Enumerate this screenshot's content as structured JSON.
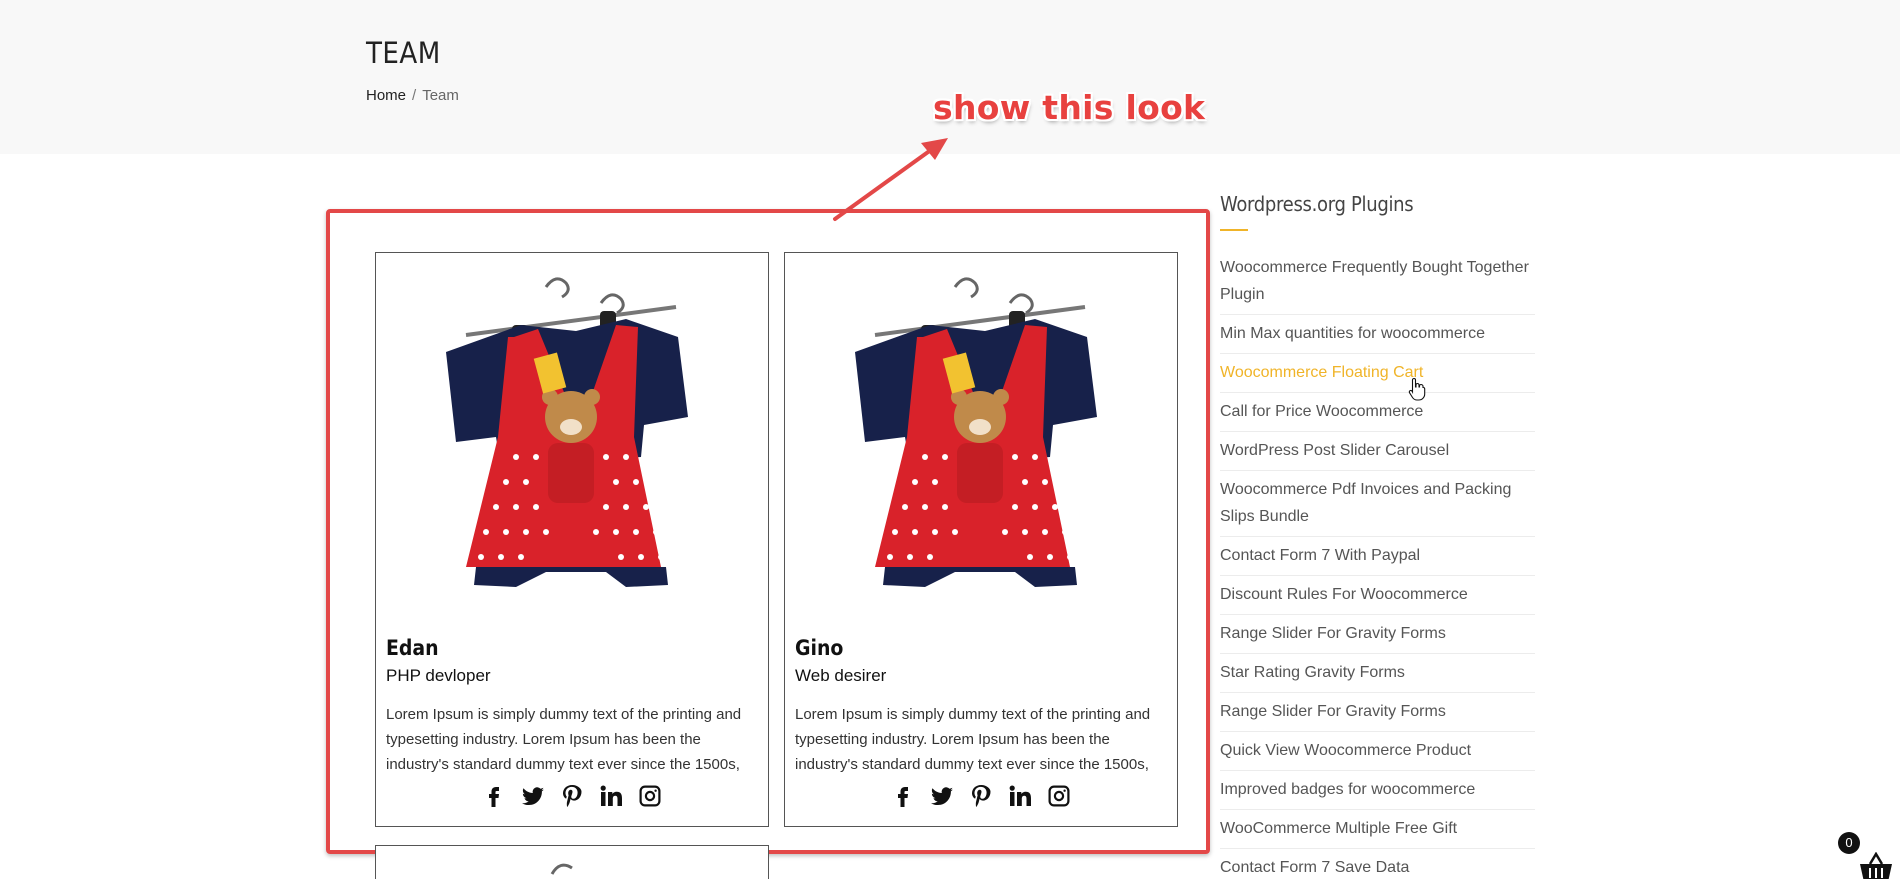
{
  "page": {
    "title": "TEAM",
    "breadcrumb": {
      "home": "Home",
      "separator": "/",
      "current": "Team"
    }
  },
  "annotation": {
    "text": "show this look",
    "color": "#e34848"
  },
  "team": [
    {
      "name": "Edan",
      "role": "PHP devloper",
      "description": "Lorem Ipsum is simply dummy text of the printing and typesetting industry. Lorem Ipsum has been the industry's standard dummy text ever since the 1500s,",
      "social": [
        "facebook-icon",
        "twitter-icon",
        "pinterest-icon",
        "linkedin-icon",
        "instagram-icon"
      ]
    },
    {
      "name": "Gino",
      "role": "Web desirer",
      "description": "Lorem Ipsum is simply dummy text of the printing and typesetting industry. Lorem Ipsum has been the industry's standard dummy text ever since the 1500s,",
      "social": [
        "facebook-icon",
        "twitter-icon",
        "pinterest-icon",
        "linkedin-icon",
        "instagram-icon"
      ]
    }
  ],
  "sidebar": {
    "title": "Wordpress.org Plugins",
    "accent_color": "#f0b429",
    "items": [
      {
        "label": "Woocommerce Frequently Bought Together Plugin"
      },
      {
        "label": "Min Max quantities for woocommerce"
      },
      {
        "label": "Woocommerce Floating Cart",
        "active": true
      },
      {
        "label": "Call for Price Woocommerce"
      },
      {
        "label": "WordPress Post Slider Carousel"
      },
      {
        "label": "Woocommerce Pdf Invoices and Packing Slips Bundle"
      },
      {
        "label": "Contact Form 7 With Paypal"
      },
      {
        "label": "Discount Rules For Woocommerce"
      },
      {
        "label": "Range Slider For Gravity Forms"
      },
      {
        "label": "Star Rating Gravity Forms"
      },
      {
        "label": "Range Slider For Gravity Forms"
      },
      {
        "label": "Quick View Woocommerce Product"
      },
      {
        "label": "Improved badges for woocommerce"
      },
      {
        "label": "WooCommerce Multiple Free Gift"
      },
      {
        "label": "Contact Form 7 Save Data"
      }
    ]
  },
  "cart": {
    "count": "0",
    "icon": "basket-icon"
  }
}
